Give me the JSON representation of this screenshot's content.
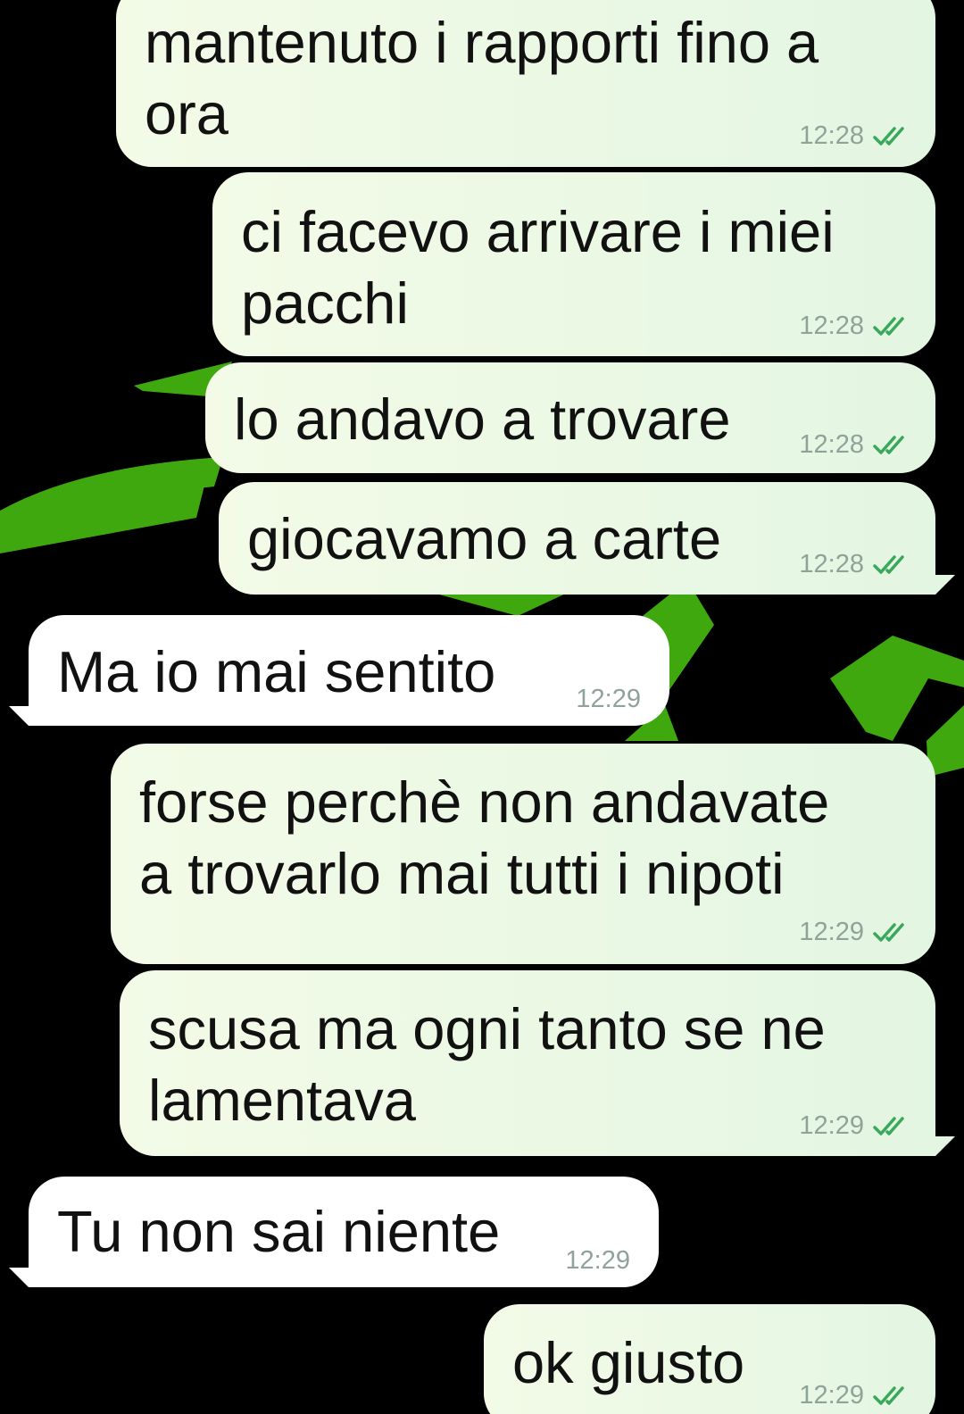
{
  "colors": {
    "background": "#000000",
    "wallpaper_accent": "#3fa80f",
    "outgoing_bubble": "#e8f8e3",
    "incoming_bubble": "#ffffff",
    "read_ticks": "#3aa85a",
    "timestamp": "#8fa39a"
  },
  "status_icon": "double-check-icon",
  "messages": [
    {
      "direction": "outgoing",
      "lines": [
        "mantenuto i rapporti fino a",
        "ora"
      ],
      "time": "12:28",
      "status": "read"
    },
    {
      "direction": "outgoing",
      "lines": [
        "ci facevo arrivare i miei",
        "pacchi"
      ],
      "time": "12:28",
      "status": "read"
    },
    {
      "direction": "outgoing",
      "lines": [
        "lo andavo a trovare"
      ],
      "time": "12:28",
      "status": "read"
    },
    {
      "direction": "outgoing",
      "lines": [
        "giocavamo a carte"
      ],
      "time": "12:28",
      "status": "read"
    },
    {
      "direction": "incoming",
      "lines": [
        "Ma io mai sentito"
      ],
      "time": "12:29"
    },
    {
      "direction": "outgoing",
      "lines": [
        "forse perchè non andavate",
        "a trovarlo mai tutti i nipoti"
      ],
      "time": "12:29",
      "status": "read"
    },
    {
      "direction": "outgoing",
      "lines": [
        "scusa ma ogni tanto se ne",
        "lamentava"
      ],
      "time": "12:29",
      "status": "read"
    },
    {
      "direction": "incoming",
      "lines": [
        "Tu non sai niente"
      ],
      "time": "12:29"
    },
    {
      "direction": "outgoing",
      "lines": [
        "ok giusto"
      ],
      "time": "12:29",
      "status": "read"
    }
  ]
}
